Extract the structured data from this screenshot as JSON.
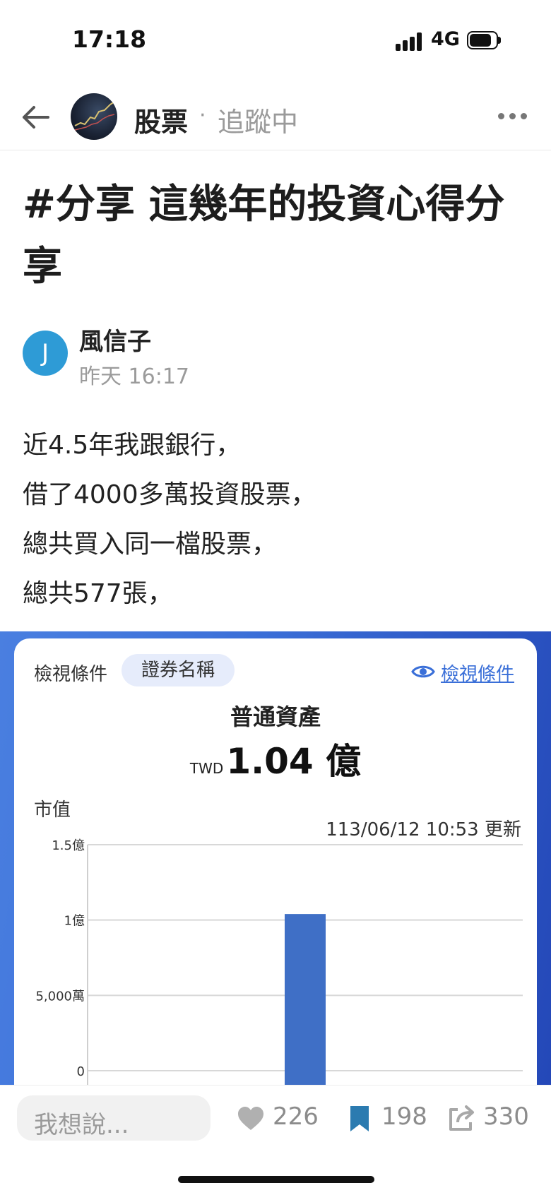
{
  "status_bar": {
    "time": "17:18",
    "network": "4G"
  },
  "nav": {
    "board": "股票",
    "separator": "·",
    "follow_status": "追蹤中"
  },
  "post": {
    "title": "#分享 這幾年的投資心得分享",
    "author": {
      "initial": "J",
      "name": "風信子",
      "time": "昨天 16:17"
    },
    "body": [
      "近4.5年我跟銀行，",
      "借了4000多萬投資股票，",
      "總共買入同一檔股票，",
      "總共577張，"
    ]
  },
  "screenshot": {
    "filter_label": "檢視條件",
    "filter_chip": "證券名稱",
    "view_link": "檢視條件",
    "asset_title": "普通資產",
    "asset_currency": "TWD",
    "asset_value": "1.04 億",
    "y_title": "市值",
    "updated": "113/06/12 10:53 更新",
    "chart_data": {
      "type": "bar",
      "ylabel": "市值",
      "y_ticks": [
        "1.5億",
        "1億",
        "5,000萬",
        "0"
      ],
      "ylim": [
        0,
        150000000
      ],
      "grid": true,
      "categories": [
        ""
      ],
      "values": [
        104000000
      ],
      "bar_color": "#3f6fc6"
    }
  },
  "bottom_bar": {
    "reply_placeholder": "我想說...",
    "likes": "226",
    "bookmarks": "198",
    "shares": "330"
  },
  "colors": {
    "accent": "#3a6fd8",
    "avatar": "#2e9bd6",
    "bookmark": "#2b7bb0"
  }
}
